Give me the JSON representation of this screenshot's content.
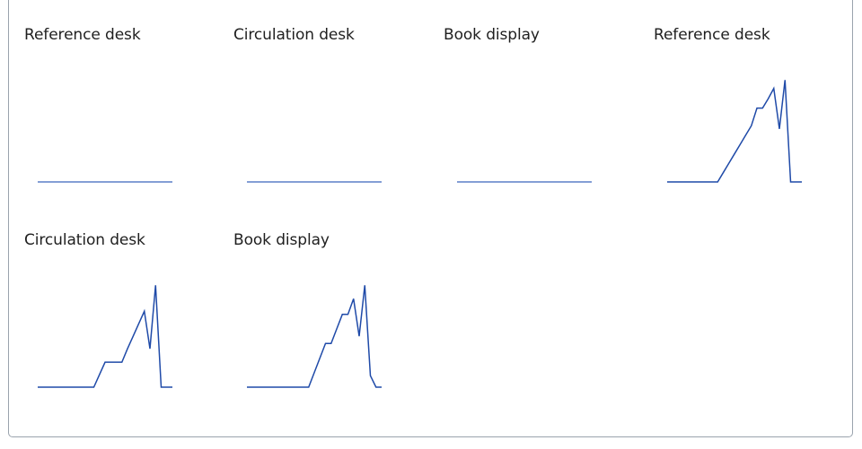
{
  "colors": {
    "line": "#1f4aa8",
    "flat_line": "#5b7fc7",
    "border": "#9aa3ad",
    "text": "#1f1f1f"
  },
  "chart_data": [
    {
      "type": "line",
      "title": "Reference desk",
      "x": [
        0,
        1,
        2,
        3,
        4,
        5,
        6,
        7,
        8,
        9,
        10,
        11,
        12,
        13,
        14,
        15,
        16,
        17,
        18,
        19,
        20,
        21,
        22,
        23,
        24
      ],
      "series": [
        {
          "values": [
            0,
            0,
            0,
            0,
            0,
            0,
            0,
            0,
            0,
            0,
            0,
            0,
            0,
            0,
            0,
            0,
            0,
            0,
            0,
            0,
            0,
            0,
            0,
            0,
            0
          ]
        }
      ],
      "ylim": [
        0,
        10
      ],
      "grid": false
    },
    {
      "type": "line",
      "title": "Circulation desk",
      "x": [
        0,
        1,
        2,
        3,
        4,
        5,
        6,
        7,
        8,
        9,
        10,
        11,
        12,
        13,
        14,
        15,
        16,
        17,
        18,
        19,
        20,
        21,
        22,
        23,
        24
      ],
      "series": [
        {
          "values": [
            0,
            0,
            0,
            0,
            0,
            0,
            0,
            0,
            0,
            0,
            0,
            0,
            0,
            0,
            0,
            0,
            0,
            0,
            0,
            0,
            0,
            0,
            0,
            0,
            0
          ]
        }
      ],
      "ylim": [
        0,
        10
      ],
      "grid": false
    },
    {
      "type": "line",
      "title": "Book display",
      "x": [
        0,
        1,
        2,
        3,
        4,
        5,
        6,
        7,
        8,
        9,
        10,
        11,
        12,
        13,
        14,
        15,
        16,
        17,
        18,
        19,
        20,
        21,
        22,
        23,
        24
      ],
      "series": [
        {
          "values": [
            0,
            0,
            0,
            0,
            0,
            0,
            0,
            0,
            0,
            0,
            0,
            0,
            0,
            0,
            0,
            0,
            0,
            0,
            0,
            0,
            0,
            0,
            0,
            0,
            0
          ]
        }
      ],
      "ylim": [
        0,
        10
      ],
      "grid": false
    },
    {
      "type": "line",
      "title": "Reference desk",
      "x": [
        0,
        1,
        2,
        3,
        4,
        5,
        6,
        7,
        8,
        9,
        10,
        11,
        12,
        13,
        14,
        15,
        16,
        17,
        18,
        19,
        20,
        21,
        22,
        23,
        24
      ],
      "series": [
        {
          "values": [
            0,
            0,
            0,
            0,
            0,
            0,
            0,
            0,
            0,
            0,
            0.9,
            1.8,
            2.7,
            3.6,
            4.5,
            5.4,
            7.1,
            7.1,
            8.0,
            9.0,
            5.1,
            9.8,
            0,
            0,
            0
          ]
        }
      ],
      "ylim": [
        0,
        10
      ],
      "grid": false
    },
    {
      "type": "line",
      "title": "Circulation desk",
      "x": [
        0,
        1,
        2,
        3,
        4,
        5,
        6,
        7,
        8,
        9,
        10,
        11,
        12,
        13,
        14,
        15,
        16,
        17,
        18,
        19,
        20,
        21,
        22,
        23,
        24
      ],
      "series": [
        {
          "values": [
            0,
            0,
            0,
            0,
            0,
            0,
            0,
            0,
            0,
            0,
            0,
            1.2,
            2.4,
            2.4,
            2.4,
            2.4,
            3.7,
            4.9,
            6.1,
            7.3,
            3.7,
            9.8,
            0,
            0,
            0
          ]
        }
      ],
      "ylim": [
        0,
        10
      ],
      "grid": false
    },
    {
      "type": "line",
      "title": "Book display",
      "x": [
        0,
        1,
        2,
        3,
        4,
        5,
        6,
        7,
        8,
        9,
        10,
        11,
        12,
        13,
        14,
        15,
        16,
        17,
        18,
        19,
        20,
        21,
        22,
        23,
        24
      ],
      "series": [
        {
          "values": [
            0,
            0,
            0,
            0,
            0,
            0,
            0,
            0,
            0,
            0,
            0,
            0,
            1.4,
            2.8,
            4.2,
            4.2,
            5.6,
            7.0,
            7.0,
            8.5,
            4.9,
            9.8,
            1.1,
            0,
            0
          ]
        }
      ],
      "ylim": [
        0,
        10
      ],
      "grid": false
    }
  ]
}
